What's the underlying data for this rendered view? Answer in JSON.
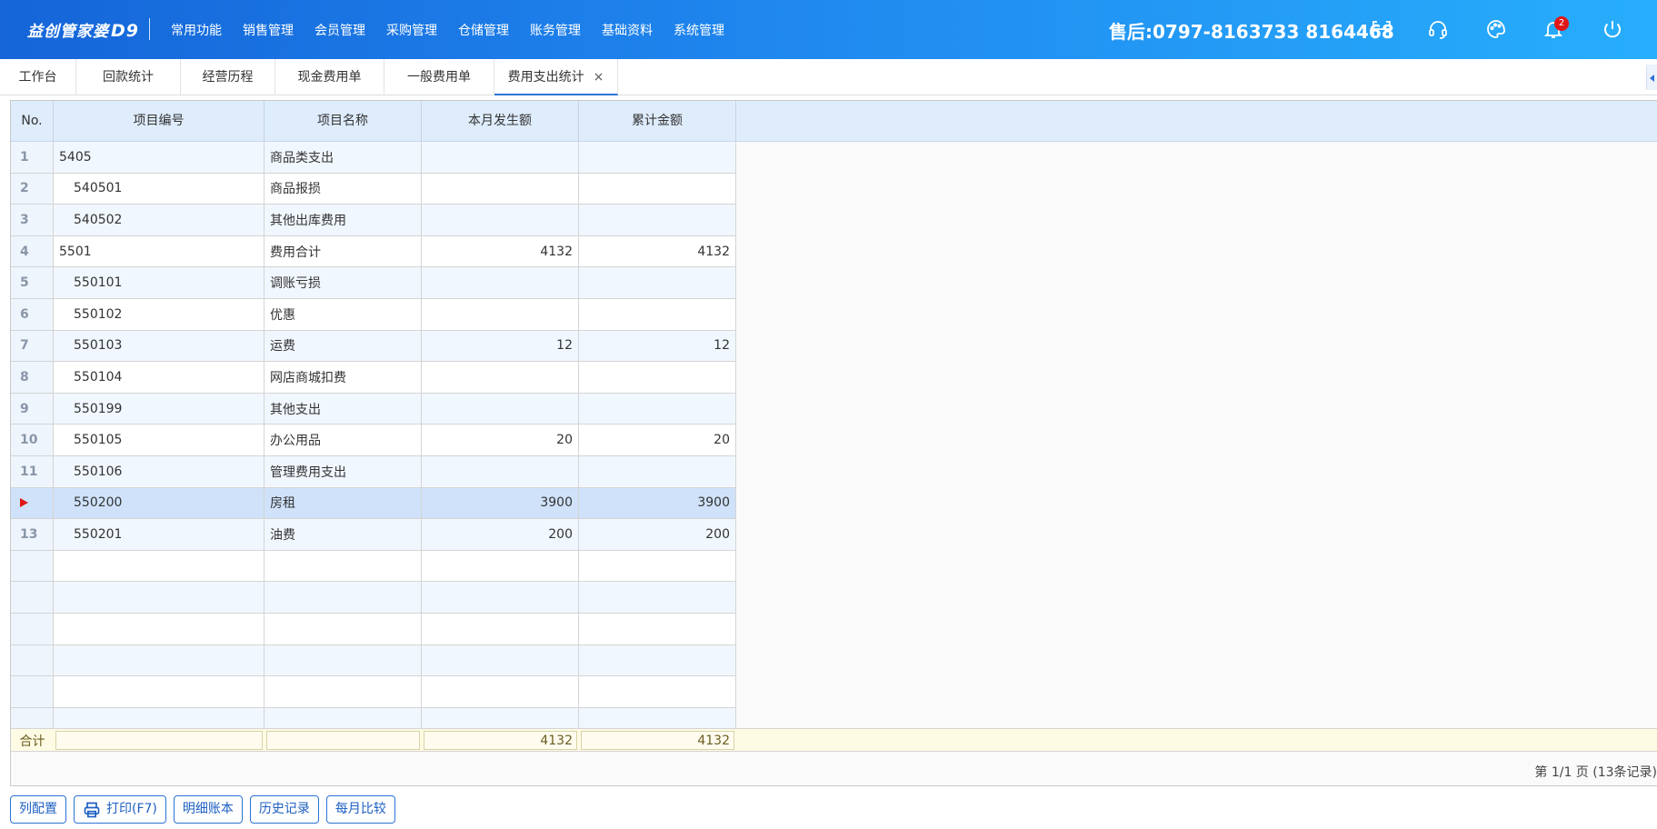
{
  "header": {
    "logo_text": "益创管家婆",
    "logo_version": "D9",
    "nav": [
      "常用功能",
      "销售管理",
      "会员管理",
      "采购管理",
      "仓储管理",
      "账务管理",
      "基础资料",
      "系统管理"
    ],
    "hotline": "售后:0797-8163733  8164468",
    "notification_count": "2",
    "icons": [
      "scan-icon",
      "headset-icon",
      "palette-icon",
      "bell-icon",
      "power-icon"
    ]
  },
  "tabs": {
    "items": [
      "工作台",
      "回款统计",
      "经营历程",
      "现金费用单",
      "一般费用单",
      "费用支出统计"
    ],
    "active_index": 5,
    "close_symbol": "×"
  },
  "grid": {
    "columns": [
      "No.",
      "项目编号",
      "项目名称",
      "本月发生额",
      "累计金额"
    ],
    "rows": [
      {
        "no": "1",
        "code": "5405",
        "name": "商品类支出",
        "month": "",
        "total": "",
        "level": 0
      },
      {
        "no": "2",
        "code": "540501",
        "name": "商品报损",
        "month": "",
        "total": "",
        "level": 1
      },
      {
        "no": "3",
        "code": "540502",
        "name": "其他出库费用",
        "month": "",
        "total": "",
        "level": 1
      },
      {
        "no": "4",
        "code": "5501",
        "name": "费用合计",
        "month": "4132",
        "total": "4132",
        "level": 0
      },
      {
        "no": "5",
        "code": "550101",
        "name": "调账亏损",
        "month": "",
        "total": "",
        "level": 1
      },
      {
        "no": "6",
        "code": "550102",
        "name": "优惠",
        "month": "",
        "total": "",
        "level": 1
      },
      {
        "no": "7",
        "code": "550103",
        "name": "运费",
        "month": "12",
        "total": "12",
        "level": 1
      },
      {
        "no": "8",
        "code": "550104",
        "name": "网店商城扣费",
        "month": "",
        "total": "",
        "level": 1
      },
      {
        "no": "9",
        "code": "550199",
        "name": "其他支出",
        "month": "",
        "total": "",
        "level": 1
      },
      {
        "no": "10",
        "code": "550105",
        "name": "办公用品",
        "month": "20",
        "total": "20",
        "level": 1
      },
      {
        "no": "11",
        "code": "550106",
        "name": "管理费用支出",
        "month": "",
        "total": "",
        "level": 1
      },
      {
        "no": "",
        "code": "550200",
        "name": "房租",
        "month": "3900",
        "total": "3900",
        "level": 1,
        "selected": true
      },
      {
        "no": "13",
        "code": "550201",
        "name": "油费",
        "month": "200",
        "total": "200",
        "level": 1
      }
    ],
    "empty_rows": 6,
    "footer": {
      "label": "合计",
      "month": "4132",
      "total": "4132"
    },
    "pager": "第 1/1 页 (13条记录)"
  },
  "buttons": [
    "列配置",
    "打印(F7)",
    "明细账本",
    "历史记录",
    "每月比较"
  ],
  "colors": {
    "header_start": "#1565d8",
    "header_end": "#27aefc",
    "accent": "#2b73d6",
    "selected_row": "#cfe2fa",
    "row_pointer": "#e01616"
  }
}
